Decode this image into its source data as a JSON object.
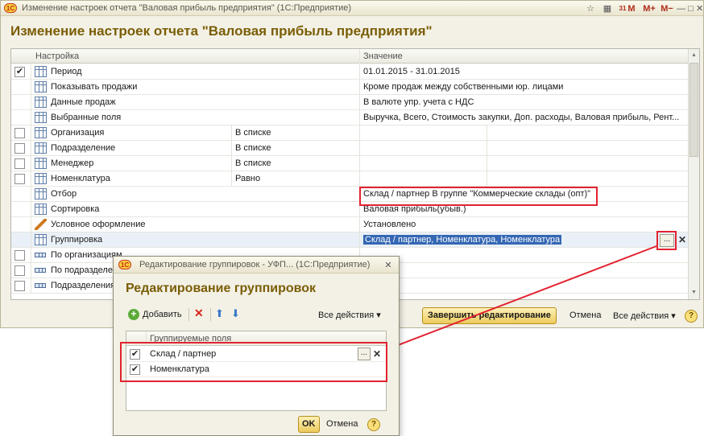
{
  "main_window": {
    "title": "Изменение настроек отчета \"Валовая прибыль предприятия\"  (1С:Предприятие)",
    "logo_text": "1С",
    "title_buttons": [
      "☆",
      "▦",
      "31",
      "M",
      "M+",
      "M−",
      "—",
      "□",
      "✕"
    ]
  },
  "form": {
    "title": "Изменение настроек отчета \"Валовая прибыль предприятия\""
  },
  "settings_grid": {
    "col_setting": "Настройка",
    "col_value": "Значение",
    "rows": [
      {
        "checked": true,
        "icon": "table",
        "label": "Период",
        "value": "01.01.2015 - 31.01.2015",
        "mode": ""
      },
      {
        "checked": null,
        "icon": "table",
        "label": "Показывать продажи",
        "value": "Кроме продаж между собственными юр. лицами",
        "mode": ""
      },
      {
        "checked": null,
        "icon": "table",
        "label": "Данные продаж",
        "value": "В валюте упр. учета с НДС",
        "mode": ""
      },
      {
        "checked": null,
        "icon": "table",
        "label": "Выбранные поля",
        "value": "Выручка, Всего, Стоимость закупки, Доп. расходы, Валовая прибыль, Рент...",
        "mode": ""
      },
      {
        "checked": false,
        "icon": "table",
        "label": "Организация",
        "value": "",
        "mode": "В списке"
      },
      {
        "checked": false,
        "icon": "table",
        "label": "Подразделение",
        "value": "",
        "mode": "В списке"
      },
      {
        "checked": false,
        "icon": "table",
        "label": "Менеджер",
        "value": "",
        "mode": "В списке"
      },
      {
        "checked": false,
        "icon": "table",
        "label": "Номенклатура",
        "value": "",
        "mode": "Равно"
      },
      {
        "checked": null,
        "icon": "table",
        "label": "Отбор",
        "value": "Склад / партнер В группе \"Коммерческие склады (опт)\"",
        "mode": ""
      },
      {
        "checked": null,
        "icon": "table",
        "label": "Сортировка",
        "value": "Валовая прибыль(убыв.)",
        "mode": ""
      },
      {
        "checked": null,
        "icon": "pen",
        "label": "Условное оформление",
        "value": "Установлено",
        "mode": ""
      },
      {
        "checked": null,
        "icon": "table",
        "label": "Группировка",
        "value": "Склад / партнер, Номенклатура, Номенклатура",
        "mode": ""
      },
      {
        "checked": false,
        "icon": "group",
        "label": "По организациям",
        "value": "",
        "mode": ""
      },
      {
        "checked": false,
        "icon": "group",
        "label": "По подразделениям",
        "value": "",
        "mode": ""
      },
      {
        "checked": false,
        "icon": "group",
        "label": "Подразделения",
        "value": "",
        "mode": ""
      }
    ],
    "ellipsis": "...",
    "clear": "✕"
  },
  "footer": {
    "finish_button": "Завершить редактирование",
    "cancel_link": "Отмена",
    "all_actions": "Все действия",
    "help": "?"
  },
  "dialog": {
    "title": "Редактирование группировок - УФП...  (1С:Предприятие)",
    "close": "✕",
    "heading": "Редактирование группировок",
    "toolbar": {
      "add": "Добавить",
      "all_actions": "Все действия"
    },
    "grid_header": "Группируемые поля",
    "rows": [
      {
        "checked": true,
        "label": "Склад / партнер"
      },
      {
        "checked": true,
        "label": "Номенклатура"
      }
    ],
    "ellipsis": "...",
    "clear": "✕",
    "ok": "OK",
    "cancel": "Отмена",
    "help": "?"
  },
  "accent_colors": {
    "title": "#7a5d05",
    "highlight_box": "#e22330",
    "selection": "#3467b3"
  }
}
